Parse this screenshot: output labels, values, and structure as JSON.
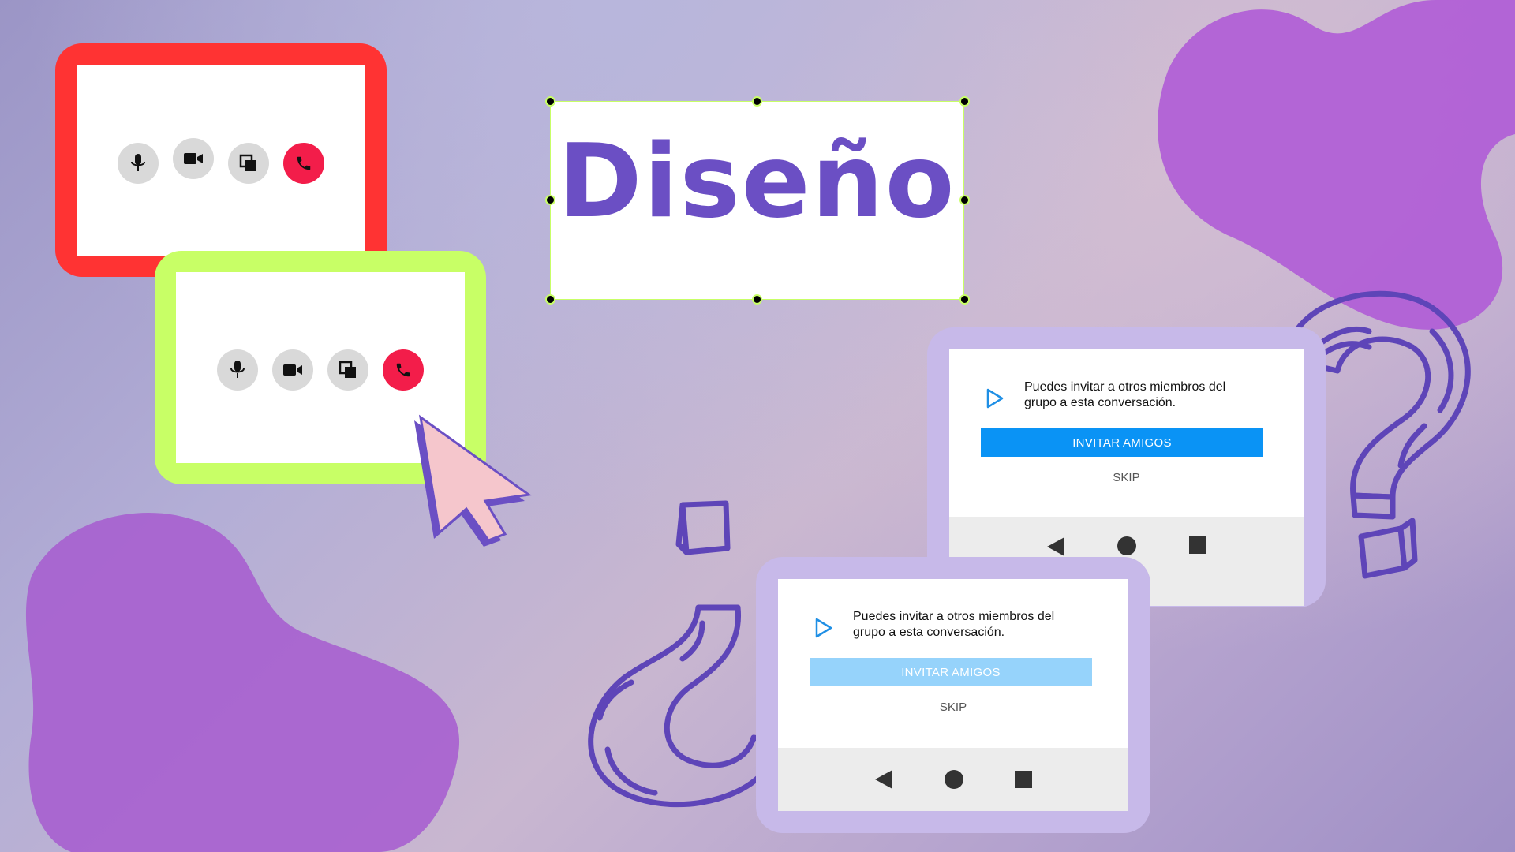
{
  "colors": {
    "accent_purple": "#6b4fc4",
    "call_red_frame": "#ff3333",
    "call_green_frame": "#c8ff66",
    "end_call": "#f31d4a",
    "invite_active": "#0a93f5",
    "invite_disabled": "#96d3fb",
    "cursor_pink": "#f5c6cc",
    "blob_purple": "#a75fcf"
  },
  "title": {
    "text": "Diseño"
  },
  "call_panel": {
    "icons": [
      "microphone-icon",
      "video-camera-icon",
      "screen-share-icon",
      "end-call-icon"
    ]
  },
  "invite_cards": [
    {
      "message": "Puedes invitar a otros miembros del grupo a esta conversación.",
      "button_label": "INVITAR AMIGOS",
      "button_state": "active",
      "skip_label": "SKIP"
    },
    {
      "message": "Puedes invitar a otros miembros del grupo a esta conversación.",
      "button_label": "INVITAR AMIGOS",
      "button_state": "disabled",
      "skip_label": "SKIP"
    }
  ],
  "navbar_icons": [
    "back-triangle-icon",
    "home-circle-icon",
    "recents-square-icon"
  ],
  "decorations": [
    "question-mark-icon",
    "inverted-question-mark-icon",
    "cursor-arrow-icon"
  ]
}
